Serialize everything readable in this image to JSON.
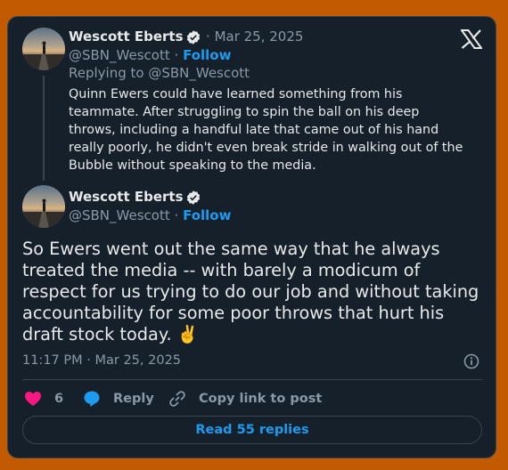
{
  "reply_tweet": {
    "author_name": "Wescott Eberts",
    "date_sep": "·",
    "date": "Mar 25, 2025",
    "handle": "@SBN_Wescott",
    "handle_sep": "·",
    "follow_label": "Follow",
    "replying_to": "Replying to @SBN_Wescott",
    "text": "Quinn Ewers could have learned something from his teammate. After struggling to spin the ball on his deep throws, including a handful late that came out of his hand really poorly, he didn't even break stride in walking out of the Bubble without speaking to the media."
  },
  "main_tweet": {
    "author_name": "Wescott Eberts",
    "handle": "@SBN_Wescott",
    "handle_sep": "·",
    "follow_label": "Follow",
    "text": "So Ewers went out the same way that he always treated the media -- with barely a modicum of respect for us trying to do our job and without taking accountability for some poor throws that hurt his draft stock today. ✌️",
    "timestamp": "11:17 PM · Mar 25, 2025"
  },
  "actions": {
    "like_count": "6",
    "reply_label": "Reply",
    "copy_link_label": "Copy link to post"
  },
  "read_replies_label": "Read 55 replies",
  "colors": {
    "background": "#c15a00",
    "card": "#15202b",
    "accent": "#1d9bf0",
    "like": "#f91880",
    "muted": "#8b98a5"
  },
  "icons": [
    "x-logo-icon",
    "verified-badge-icon",
    "heart-icon",
    "reply-bubble-icon",
    "link-icon",
    "info-icon"
  ]
}
